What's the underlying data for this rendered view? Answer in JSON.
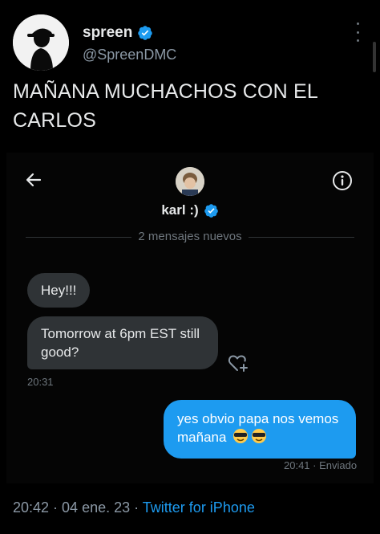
{
  "author": {
    "name": "spreen",
    "handle": "@SpreenDMC"
  },
  "tweet": {
    "text": "MAÑANA MUCHACHOS CON EL CARLOS"
  },
  "dm": {
    "contact_name": "karl :)",
    "new_messages_divider": "2 mensajes nuevos",
    "messages": [
      {
        "direction": "incoming",
        "text": "Hey!!!"
      },
      {
        "direction": "incoming",
        "text": "Tomorrow at 6pm EST still good?",
        "time": "20:31"
      },
      {
        "direction": "outgoing",
        "text": "yes obvio papa nos vemos mañana",
        "emojis": "😎😎",
        "time": "20:41",
        "status": "Enviado"
      }
    ]
  },
  "footer": {
    "timestamp": "20:42 · 04 ene. 23 · ",
    "source": "Twitter for iPhone"
  },
  "colors": {
    "background": "#000000",
    "accent": "#1d9bf0",
    "bubble_incoming": "#2f3336",
    "muted_text": "#6e767d"
  },
  "icons": [
    "verified-badge-icon",
    "more-options-icon",
    "back-arrow-icon",
    "info-icon",
    "heart-plus-icon"
  ]
}
